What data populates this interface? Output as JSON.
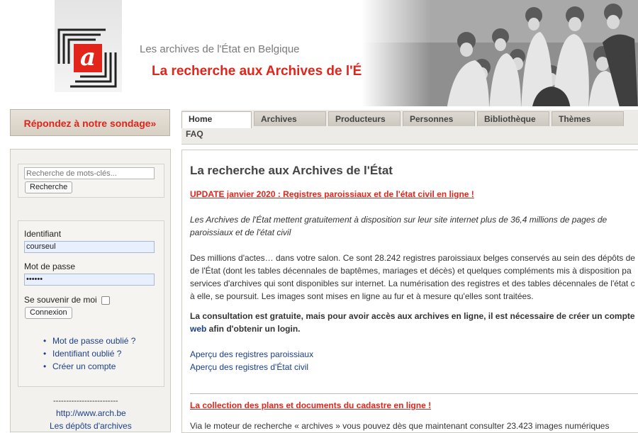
{
  "header": {
    "subtitle": "Les archives de l'État en Belgique",
    "title": "La recherche aux Archives de l'État",
    "logo_letter": "a"
  },
  "survey_label": "Répondez à notre sondage»",
  "tabs": [
    {
      "label": "Home"
    },
    {
      "label": "Archives"
    },
    {
      "label": "Producteurs"
    },
    {
      "label": "Personnes"
    },
    {
      "label": "Bibliothèque"
    },
    {
      "label": "Thèmes"
    },
    {
      "label": "FAQ"
    }
  ],
  "sidebar": {
    "search_placeholder": "Recherche de mots-clés...",
    "search_button": "Recherche",
    "login": {
      "id_label": "Identifiant",
      "id_value": "courseul",
      "password_label": "Mot de passe",
      "password_value": "••••••",
      "remember_label": "Se souvenir de moi",
      "connect_button": "Connexion"
    },
    "links": [
      "Mot de passe oublié ?",
      "Identifiant oublié ?",
      "Créer un compte"
    ],
    "separator": "-------------------------",
    "external_link": "http://www.arch.be",
    "external_link2": "Les dépôts d'archives"
  },
  "main": {
    "title": "La recherche aux Archives de l'État",
    "update_title": "UPDATE janvier 2020 : Registres paroissiaux et de l'état civil en ligne !",
    "intro_line1": "Les Archives de l'État mettent gratuitement à disposition sur leur site internet plus de 36,4 millions de pages de",
    "intro_line2": "paroissiaux et de l'état civil",
    "body_lines": [
      "Des millions d'actes… dans votre salon. Ce sont 28.242 registres paroissiaux belges conservés au sein des dépôts de",
      "de l'État (dont les tables décennales de baptêmes, mariages et décès) et quelques compléments mis à disposition pa",
      "services d'archives qui sont disponibles sur internet. La numérisation des registres et des tables décennales de l'état c",
      "à elle, se poursuit. Les images sont mises en ligne au fur et à mesure qu'elles sont traitées."
    ],
    "consult_line1": "La consultation est gratuite, mais pour avoir accès aux archives en ligne, il est nécessaire de créer un compte",
    "consult_link": "web",
    "consult_line2_rest": " afin d'obtenir un login.",
    "apercu_links": [
      "Aperçu des registres paroissiaux",
      "Aperçu des registres d'État civil"
    ],
    "cadastre_title": "La collection des plans et documents du cadastre en ligne !",
    "cadastre_line": "Via le moteur de recherche « archives » vous pouvez dès que maintenant consulter 23.423 images numériques"
  },
  "colors": {
    "accent_red": "#e1251b",
    "link_blue": "#1b3f8b"
  }
}
